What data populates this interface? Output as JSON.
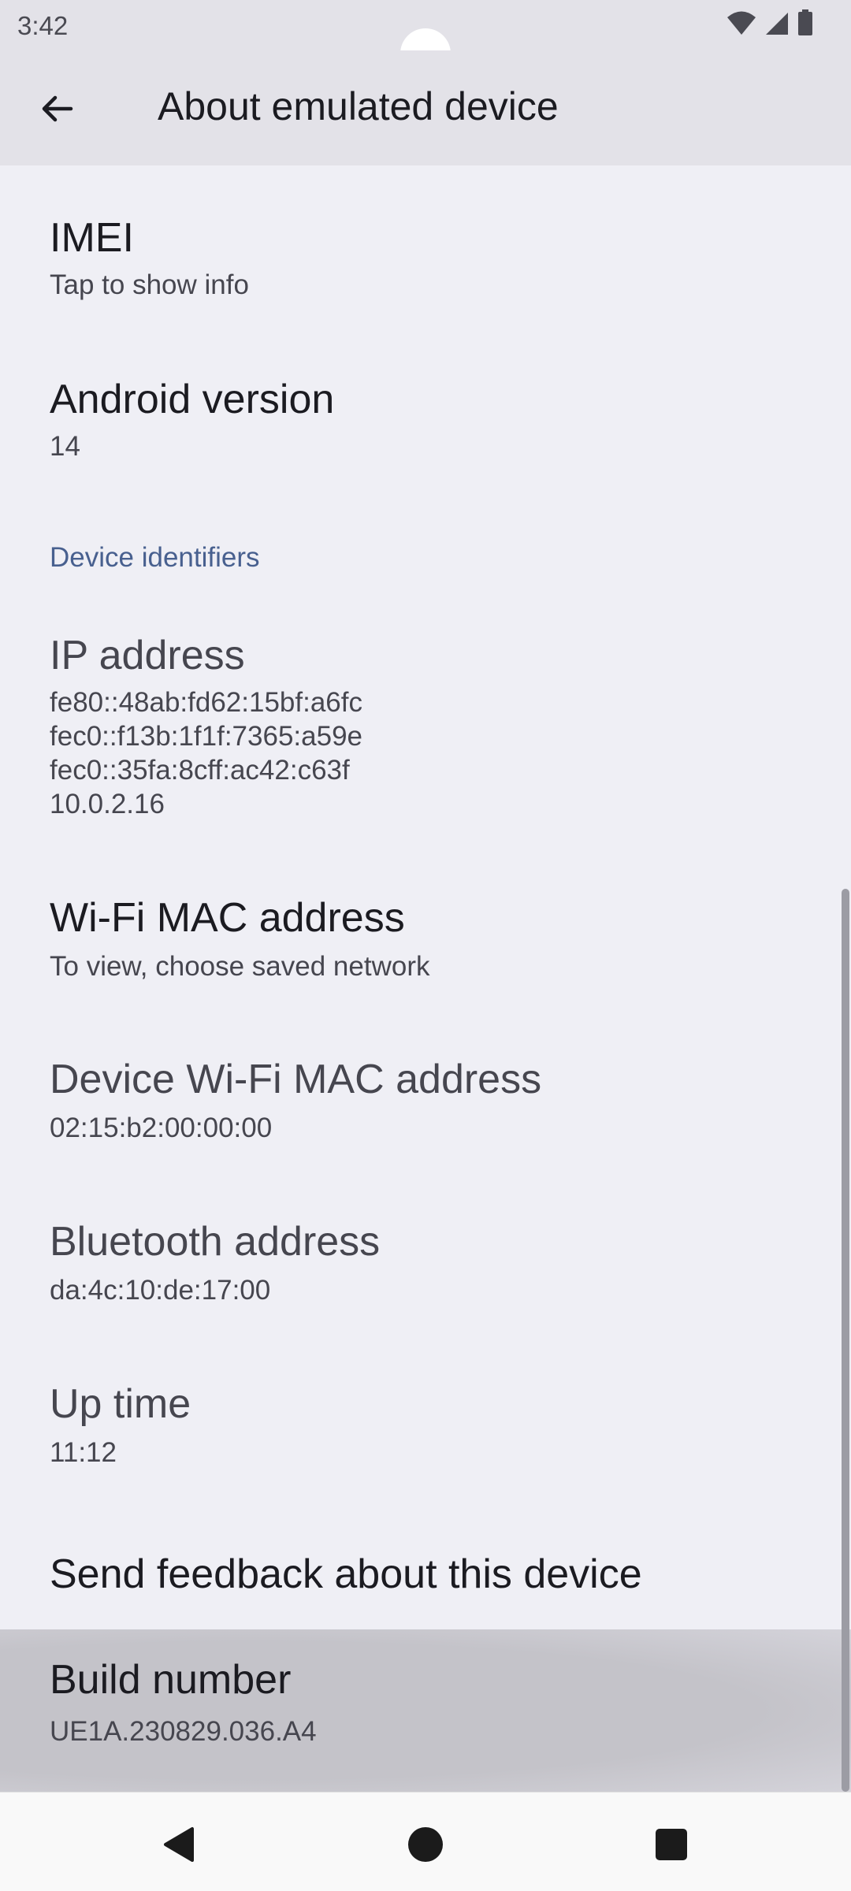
{
  "status_bar": {
    "time": "3:42",
    "icons": [
      "wifi-icon",
      "signal-icon",
      "battery-icon"
    ]
  },
  "app_bar": {
    "title": "About emulated device",
    "back_icon": "arrow-back-icon"
  },
  "items": {
    "imei": {
      "title": "IMEI",
      "summary": "Tap to show info"
    },
    "android_version": {
      "title": "Android version",
      "summary": "14"
    },
    "section_device_identifiers": "Device identifiers",
    "ip_address": {
      "title": "IP address",
      "summary": "fe80::48ab:fd62:15bf:a6fc\nfec0::f13b:1f1f:7365:a59e\nfec0::35fa:8cff:ac42:c63f\n10.0.2.16"
    },
    "wifi_mac": {
      "title": "Wi-Fi MAC address",
      "summary": "To view, choose saved network"
    },
    "device_wifi_mac": {
      "title": "Device Wi-Fi MAC address",
      "summary": "02:15:b2:00:00:00"
    },
    "bluetooth": {
      "title": "Bluetooth address",
      "summary": "da:4c:10:de:17:00"
    },
    "up_time": {
      "title": "Up time",
      "summary": "11:12"
    },
    "feedback": {
      "title": "Send feedback about this device"
    },
    "build_number": {
      "title": "Build number",
      "summary": "UE1A.230829.036.A4"
    }
  },
  "nav_bar": {
    "back": "nav-back-icon",
    "home": "nav-home-icon",
    "recents": "nav-recents-icon"
  },
  "colors": {
    "app_bar_bg": "#e3e2e8",
    "content_bg": "#efeff5",
    "section_header": "#48608f",
    "pressed_item": "#c4c3c9"
  }
}
